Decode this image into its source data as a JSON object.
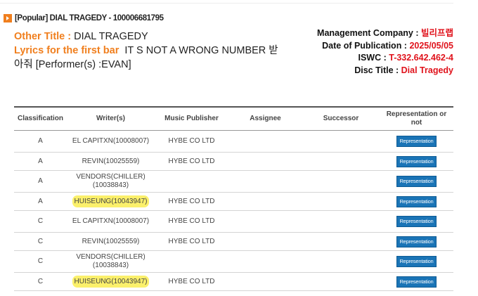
{
  "header": {
    "title": "[Popular] DIAL TRAGEDY - 100006681795",
    "icon": "arrow-right-icon"
  },
  "info": {
    "other_title_label": "Other Title : ",
    "other_title_value": "DIAL TRAGEDY",
    "lyrics_label": "Lyrics for the first bar",
    "lyrics_value": "IT S NOT A WRONG NUMBER 받",
    "lyrics_value_cont": "아줘 [Performer(s) :EVAN]"
  },
  "meta": {
    "mgmt_label": "Management Company : ",
    "mgmt_value": "빌리프랩",
    "pub_label": "Date of Publication : ",
    "pub_value": "2025/05/05",
    "iswc_label": "ISWC : ",
    "iswc_value": "T-332.642.462-4",
    "disc_label": "Disc Title : ",
    "disc_value": "Dial Tragedy"
  },
  "table": {
    "headers": [
      "Classification",
      "Writer(s)",
      "Music Publisher",
      "Assignee",
      "Successor",
      "Representation or not"
    ],
    "rows": [
      {
        "classification": "A",
        "writer": "EL CAPITXN(10008007)",
        "publisher": "HYBE CO LTD",
        "assignee": "",
        "successor": "",
        "rep": "Representation",
        "highlight": false
      },
      {
        "classification": "A",
        "writer": "REVIN(10025559)",
        "publisher": "HYBE CO LTD",
        "assignee": "",
        "successor": "",
        "rep": "Representation",
        "highlight": false
      },
      {
        "classification": "A",
        "writer": "VENDORS(CHILLER)(10038843)",
        "publisher": "",
        "assignee": "",
        "successor": "",
        "rep": "Representation",
        "highlight": false
      },
      {
        "classification": "A",
        "writer": "HUISEUNG(10043947)",
        "publisher": "HYBE CO LTD",
        "assignee": "",
        "successor": "",
        "rep": "Representation",
        "highlight": true
      },
      {
        "classification": "C",
        "writer": "EL CAPITXN(10008007)",
        "publisher": "HYBE CO LTD",
        "assignee": "",
        "successor": "",
        "rep": "Representation",
        "highlight": false
      },
      {
        "classification": "C",
        "writer": "REVIN(10025559)",
        "publisher": "HYBE CO LTD",
        "assignee": "",
        "successor": "",
        "rep": "Representation",
        "highlight": false
      },
      {
        "classification": "C",
        "writer": "VENDORS(CHILLER)(10038843)",
        "publisher": "",
        "assignee": "",
        "successor": "",
        "rep": "Representation",
        "highlight": false
      },
      {
        "classification": "C",
        "writer": "HUISEUNG(10043947)",
        "publisher": "HYBE CO LTD",
        "assignee": "",
        "successor": "",
        "rep": "Representation",
        "highlight": true
      }
    ]
  },
  "colors": {
    "accent": "#f07f1e",
    "red": "#e0121b",
    "button": "#1a74b6",
    "highlight": "#fbf06b"
  }
}
